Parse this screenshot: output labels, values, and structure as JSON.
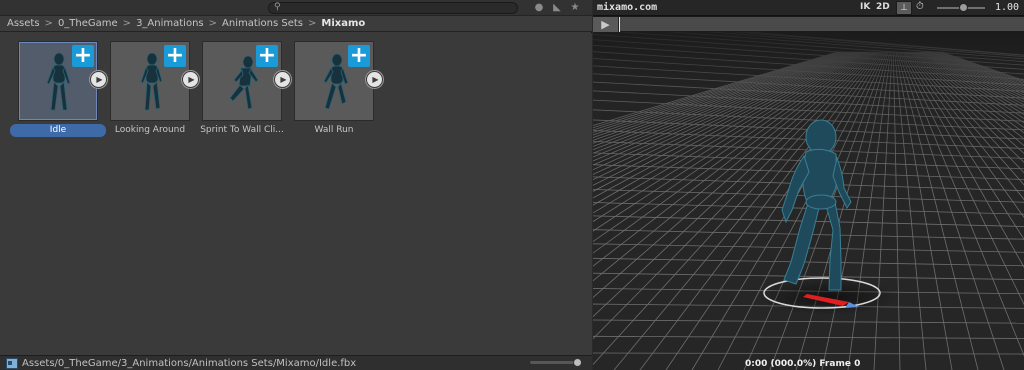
{
  "project": {
    "search": {
      "placeholder": "",
      "icon": "search-icon"
    },
    "toolbar_icons": [
      "type-filter-icon",
      "label-filter-icon",
      "favorite-star-icon"
    ],
    "breadcrumb": [
      {
        "label": "Assets"
      },
      {
        "label": "0_TheGame"
      },
      {
        "label": "3_Animations"
      },
      {
        "label": "Animations Sets"
      },
      {
        "label": "Mixamo"
      }
    ],
    "breadcrumb_separator": ">",
    "assets": [
      {
        "label": "Idle",
        "selected": true
      },
      {
        "label": "Looking Around",
        "selected": false
      },
      {
        "label": "Sprint To Wall Cli...",
        "selected": false
      },
      {
        "label": "Wall Run",
        "selected": false
      }
    ],
    "add_icon_glyph": "+",
    "play_icon_glyph": "▶",
    "status": {
      "path": "Assets/0_TheGame/3_Animations/Animations Sets/Mixamo/Idle.fbx",
      "file_icon": "prefab-file-icon"
    }
  },
  "preview": {
    "title": "mixamo.com",
    "ik_label": "IK",
    "twod_label": "2D",
    "pivot_icon": "pivot-icon",
    "speed_icon": "playback-speed-icon",
    "speed_value": "1.00",
    "play_button_glyph": "▶",
    "frame_readout": "0:00 (000.0%) Frame 0"
  },
  "colors": {
    "accent_blue": "#1a9bd7",
    "selection_blue": "#3e6aa8",
    "character": "#1f4a5c",
    "grid_line": "#6e6e6e",
    "root_arrow": "#e02020"
  }
}
